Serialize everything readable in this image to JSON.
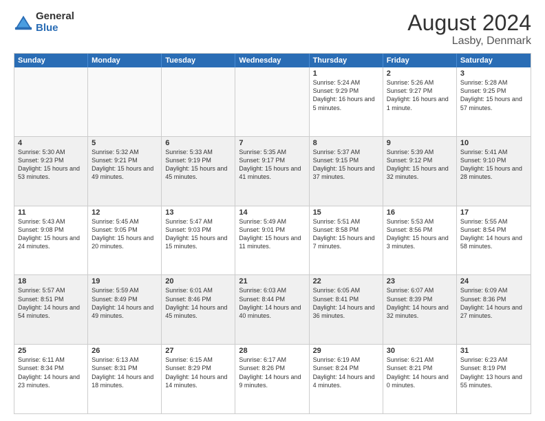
{
  "logo": {
    "general": "General",
    "blue": "Blue"
  },
  "title": "August 2024",
  "subtitle": "Lasby, Denmark",
  "header_days": [
    "Sunday",
    "Monday",
    "Tuesday",
    "Wednesday",
    "Thursday",
    "Friday",
    "Saturday"
  ],
  "weeks": [
    [
      {
        "day": "",
        "empty": true
      },
      {
        "day": "",
        "empty": true
      },
      {
        "day": "",
        "empty": true
      },
      {
        "day": "",
        "empty": true
      },
      {
        "day": "1",
        "rise": "5:24 AM",
        "set": "9:29 PM",
        "daylight": "16 hours and 5 minutes."
      },
      {
        "day": "2",
        "rise": "5:26 AM",
        "set": "9:27 PM",
        "daylight": "16 hours and 1 minute."
      },
      {
        "day": "3",
        "rise": "5:28 AM",
        "set": "9:25 PM",
        "daylight": "15 hours and 57 minutes."
      }
    ],
    [
      {
        "day": "4",
        "rise": "5:30 AM",
        "set": "9:23 PM",
        "daylight": "15 hours and 53 minutes."
      },
      {
        "day": "5",
        "rise": "5:32 AM",
        "set": "9:21 PM",
        "daylight": "15 hours and 49 minutes."
      },
      {
        "day": "6",
        "rise": "5:33 AM",
        "set": "9:19 PM",
        "daylight": "15 hours and 45 minutes."
      },
      {
        "day": "7",
        "rise": "5:35 AM",
        "set": "9:17 PM",
        "daylight": "15 hours and 41 minutes."
      },
      {
        "day": "8",
        "rise": "5:37 AM",
        "set": "9:15 PM",
        "daylight": "15 hours and 37 minutes."
      },
      {
        "day": "9",
        "rise": "5:39 AM",
        "set": "9:12 PM",
        "daylight": "15 hours and 32 minutes."
      },
      {
        "day": "10",
        "rise": "5:41 AM",
        "set": "9:10 PM",
        "daylight": "15 hours and 28 minutes."
      }
    ],
    [
      {
        "day": "11",
        "rise": "5:43 AM",
        "set": "9:08 PM",
        "daylight": "15 hours and 24 minutes."
      },
      {
        "day": "12",
        "rise": "5:45 AM",
        "set": "9:05 PM",
        "daylight": "15 hours and 20 minutes."
      },
      {
        "day": "13",
        "rise": "5:47 AM",
        "set": "9:03 PM",
        "daylight": "15 hours and 15 minutes."
      },
      {
        "day": "14",
        "rise": "5:49 AM",
        "set": "9:01 PM",
        "daylight": "15 hours and 11 minutes."
      },
      {
        "day": "15",
        "rise": "5:51 AM",
        "set": "8:58 PM",
        "daylight": "15 hours and 7 minutes."
      },
      {
        "day": "16",
        "rise": "5:53 AM",
        "set": "8:56 PM",
        "daylight": "15 hours and 3 minutes."
      },
      {
        "day": "17",
        "rise": "5:55 AM",
        "set": "8:54 PM",
        "daylight": "14 hours and 58 minutes."
      }
    ],
    [
      {
        "day": "18",
        "rise": "5:57 AM",
        "set": "8:51 PM",
        "daylight": "14 hours and 54 minutes."
      },
      {
        "day": "19",
        "rise": "5:59 AM",
        "set": "8:49 PM",
        "daylight": "14 hours and 49 minutes."
      },
      {
        "day": "20",
        "rise": "6:01 AM",
        "set": "8:46 PM",
        "daylight": "14 hours and 45 minutes."
      },
      {
        "day": "21",
        "rise": "6:03 AM",
        "set": "8:44 PM",
        "daylight": "14 hours and 40 minutes."
      },
      {
        "day": "22",
        "rise": "6:05 AM",
        "set": "8:41 PM",
        "daylight": "14 hours and 36 minutes."
      },
      {
        "day": "23",
        "rise": "6:07 AM",
        "set": "8:39 PM",
        "daylight": "14 hours and 32 minutes."
      },
      {
        "day": "24",
        "rise": "6:09 AM",
        "set": "8:36 PM",
        "daylight": "14 hours and 27 minutes."
      }
    ],
    [
      {
        "day": "25",
        "rise": "6:11 AM",
        "set": "8:34 PM",
        "daylight": "14 hours and 23 minutes."
      },
      {
        "day": "26",
        "rise": "6:13 AM",
        "set": "8:31 PM",
        "daylight": "14 hours and 18 minutes."
      },
      {
        "day": "27",
        "rise": "6:15 AM",
        "set": "8:29 PM",
        "daylight": "14 hours and 14 minutes."
      },
      {
        "day": "28",
        "rise": "6:17 AM",
        "set": "8:26 PM",
        "daylight": "14 hours and 9 minutes."
      },
      {
        "day": "29",
        "rise": "6:19 AM",
        "set": "8:24 PM",
        "daylight": "14 hours and 4 minutes."
      },
      {
        "day": "30",
        "rise": "6:21 AM",
        "set": "8:21 PM",
        "daylight": "14 hours and 0 minutes."
      },
      {
        "day": "31",
        "rise": "6:23 AM",
        "set": "8:19 PM",
        "daylight": "13 hours and 55 minutes."
      }
    ]
  ]
}
